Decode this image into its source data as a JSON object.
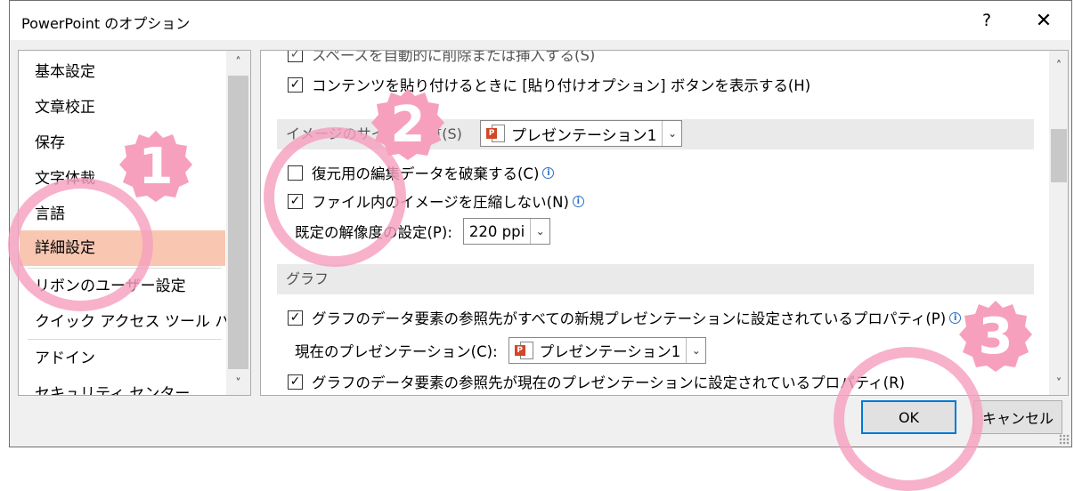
{
  "window": {
    "title": "PowerPoint のオプション",
    "help_label": "?",
    "close_label": "✕"
  },
  "sidebar": {
    "items": [
      {
        "label": "基本設定"
      },
      {
        "label": "文章校正"
      },
      {
        "label": "保存"
      },
      {
        "label": "文字体裁"
      },
      {
        "label": "言語"
      },
      {
        "label": "詳細設定",
        "selected": true
      },
      {
        "label": "リボンのユーザー設定"
      },
      {
        "label": "クイック アクセス ツール バー"
      },
      {
        "label": "アドイン"
      },
      {
        "label": "セキュリティ センター"
      }
    ]
  },
  "content": {
    "top_partial_label": "スペースを自動的に削除または挿入する(S)",
    "paste_options": {
      "checked": true,
      "label": "コンテンツを貼り付けるときに [貼り付けオプション] ボタンを表示する(H)"
    },
    "image_section": {
      "label": "イメージのサイズと画質(S)",
      "presentation": "プレゼンテーション1",
      "discard_editing": {
        "checked": false,
        "label": "復元用の編集データを破棄する(C)"
      },
      "no_compress": {
        "checked": true,
        "label": "ファイル内のイメージを圧縮しない(N)"
      },
      "resolution_label": "既定の解像度の設定(P):",
      "resolution_value": "220 ppi"
    },
    "chart_section": {
      "label": "グラフ",
      "all_new": {
        "checked": true,
        "label": "グラフのデータ要素の参照先がすべての新規プレゼンテーションに設定されているプロパティ(P)"
      },
      "current_label": "現在のプレゼンテーション(C):",
      "current_value": "プレゼンテーション1",
      "current_prop": {
        "checked": true,
        "label": "グラフのデータ要素の参照先が現在のプレゼンテーションに設定されているプロパティ(R)"
      }
    }
  },
  "buttons": {
    "ok": "OK",
    "cancel": "キャンセル"
  },
  "annotations": {
    "step1": "1",
    "step2": "2",
    "step3": "3",
    "color": "#f6a0be"
  },
  "icons": {
    "checkmark": "✓",
    "info": "i",
    "chevron_down": "⌄",
    "scroll_up": "˄",
    "scroll_down": "˅",
    "ppt_badge": "P"
  }
}
